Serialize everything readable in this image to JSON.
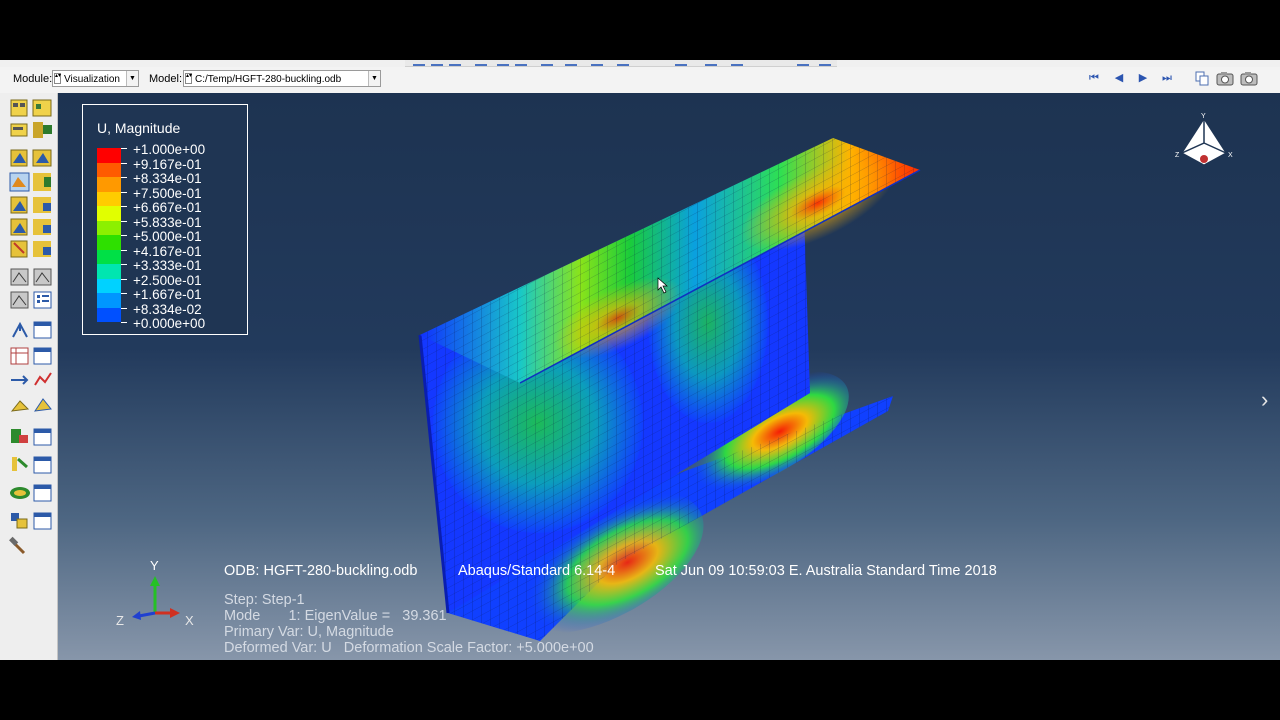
{
  "context_bar": {
    "module_label": "Module:",
    "module_value": "Visualization",
    "model_label": "Model:",
    "model_value": "C:/Temp/HGFT-280-buckling.odb"
  },
  "legend": {
    "title": "U, Magnitude",
    "entries": [
      {
        "value": "+1.000e+00",
        "color": "#ff0000"
      },
      {
        "value": "+9.167e-01",
        "color": "#ff5a00"
      },
      {
        "value": "+8.334e-01",
        "color": "#ff9900"
      },
      {
        "value": "+7.500e-01",
        "color": "#ffcc00"
      },
      {
        "value": "+6.667e-01",
        "color": "#e1ff00"
      },
      {
        "value": "+5.833e-01",
        "color": "#8cf000"
      },
      {
        "value": "+5.000e-01",
        "color": "#2ee000"
      },
      {
        "value": "+4.167e-01",
        "color": "#00e046"
      },
      {
        "value": "+3.333e-01",
        "color": "#00e6b0"
      },
      {
        "value": "+2.500e-01",
        "color": "#00d2ff"
      },
      {
        "value": "+1.667e-01",
        "color": "#0096ff"
      },
      {
        "value": "+8.334e-02",
        "color": "#0050ff"
      },
      {
        "value": "+0.000e+00",
        "color": "#0000ff"
      }
    ]
  },
  "info": {
    "odb_line": "ODB: HGFT-280-buckling.odb",
    "solver_line": "Abaqus/Standard 6.14-4",
    "date_line": "Sat Jun 09 10:59:03 E. Australia Standard Time 2018",
    "step_line": "Step: Step-1",
    "mode_line": "Mode       1: EigenValue =   39.361",
    "primary_var_line": "Primary Var: U, Magnitude",
    "deformed_var_line": "Deformed Var: U   Deformation Scale Factor: +5.000e+00"
  },
  "triad": {
    "x": "X",
    "y": "Y",
    "z": "Z"
  },
  "view_cube": {
    "x": "X",
    "y": "Y",
    "z": "Z"
  },
  "icons": {
    "nav_first": "skip-first-icon",
    "nav_prev": "step-back-icon",
    "nav_next": "step-forward-icon",
    "nav_last": "skip-last-icon",
    "next_arrow": "chevron-right-icon"
  },
  "nav_glyphs": {
    "first": "⏮",
    "prev": "◀",
    "next": "▶",
    "last": "⏭",
    "chevron": "›"
  }
}
